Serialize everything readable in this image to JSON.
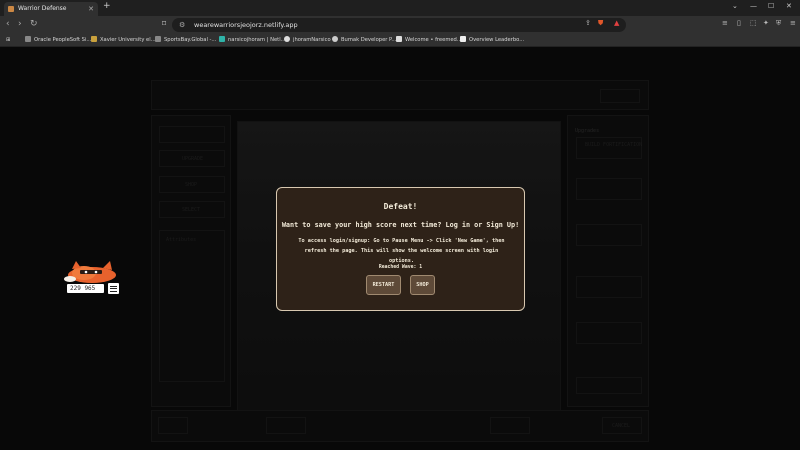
{
  "browser": {
    "tab_title": "Warrior Defense",
    "url": "wearewarriorsjeojorz.netlify.app",
    "bookmarks": [
      "Oracle PeopleSoft Si...",
      "Xavier University el...",
      "SportsBay.Global -...",
      "narsicojhoram | Netl...",
      "jhoramNarsico",
      "Bumak Developer P...",
      "Welcome • freemed...",
      "Overview Leaderbo..."
    ]
  },
  "game_background": {
    "upgrades_title": "Upgrades",
    "attributes_title": "Attributes",
    "upgrade_label": "BUILD FORTIFICATION",
    "menu_items": [
      "UPGRADE",
      "SHOP",
      "SELECT"
    ],
    "cancel_label": "CANCEL"
  },
  "modal": {
    "title": "Defeat!",
    "subtitle": "Want to save your high score next time? Log in or Sign Up!",
    "info": "To access login/signup: Go to Pause Menu -> Click 'New Game', then refresh the page. This will show the welcome screen with login options.",
    "wave": "Reached Wave: 1",
    "restart_label": "RESTART",
    "shop_label": "SHOP"
  },
  "widget": {
    "counter_value": "229 965",
    "cat_icon": "cat-icon",
    "menu_icon": "hamburger-icon"
  }
}
